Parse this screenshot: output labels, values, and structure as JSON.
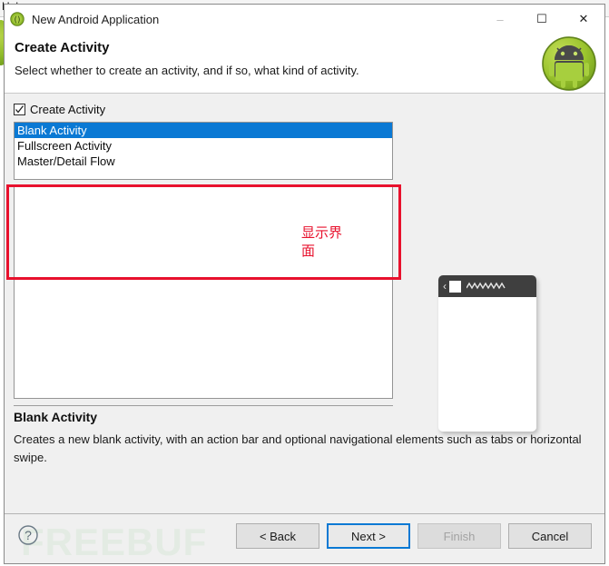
{
  "background": {
    "menu_help": "Help"
  },
  "window": {
    "title": "New Android Application",
    "icon": "android-wizard-icon",
    "controls": {
      "minimize": "–",
      "maximize": "☐",
      "close": "✕"
    }
  },
  "header": {
    "title": "Create Activity",
    "subtitle": "Select whether to create an activity, and if so, what kind of activity.",
    "logo": "android-robot-logo"
  },
  "form": {
    "create_activity_checkbox": {
      "label": "Create Activity",
      "checked": true
    },
    "activity_list": {
      "items": [
        {
          "label": "Blank Activity",
          "selected": true
        },
        {
          "label": "Fullscreen Activity",
          "selected": false
        },
        {
          "label": "Master/Detail Flow",
          "selected": false
        }
      ]
    }
  },
  "annotation": {
    "text": "显示界面",
    "color": "#e8112d",
    "box_color": "#e8112d"
  },
  "preview": {
    "phone": {
      "back_icon": "‹",
      "app_icon": "app-square-icon",
      "title_placeholder": "zigzag-title-placeholder",
      "overflow_icon": "overflow-menu-icon"
    }
  },
  "description": {
    "title": "Blank Activity",
    "body": "Creates a new blank activity, with an action bar and optional navigational elements such as tabs or horizontal swipe."
  },
  "footer": {
    "help_icon": "?",
    "watermark": "FREEBUF",
    "buttons": [
      {
        "label": "< Back",
        "state": "enabled",
        "name": "back-button"
      },
      {
        "label": "Next >",
        "state": "focused",
        "name": "next-button"
      },
      {
        "label": "Finish",
        "state": "disabled",
        "name": "finish-button"
      },
      {
        "label": "Cancel",
        "state": "enabled",
        "name": "cancel-button"
      }
    ]
  },
  "colors": {
    "selection_blue": "#0a79d4",
    "annotation_red": "#e8112d",
    "dialog_bg": "#f0f0f0",
    "actionbar_dark": "#3f3f3f"
  }
}
